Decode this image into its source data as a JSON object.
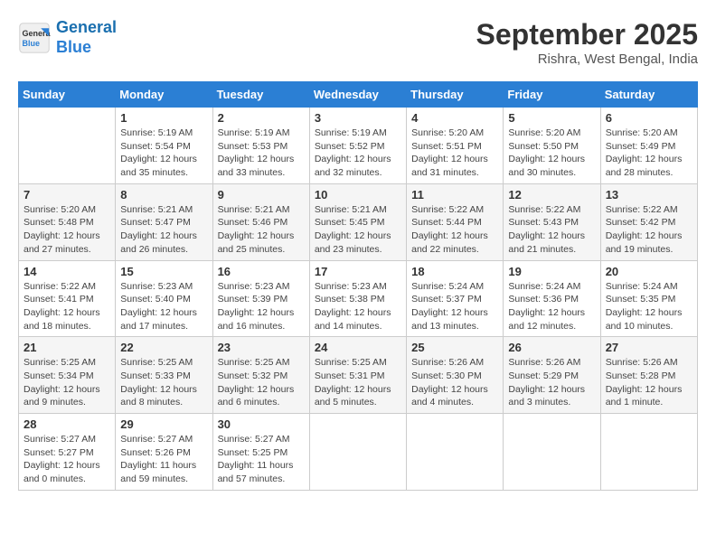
{
  "header": {
    "logo_line1": "General",
    "logo_line2": "Blue",
    "month": "September 2025",
    "location": "Rishra, West Bengal, India"
  },
  "days_of_week": [
    "Sunday",
    "Monday",
    "Tuesday",
    "Wednesday",
    "Thursday",
    "Friday",
    "Saturday"
  ],
  "weeks": [
    [
      {
        "day": "",
        "info": ""
      },
      {
        "day": "1",
        "info": "Sunrise: 5:19 AM\nSunset: 5:54 PM\nDaylight: 12 hours\nand 35 minutes."
      },
      {
        "day": "2",
        "info": "Sunrise: 5:19 AM\nSunset: 5:53 PM\nDaylight: 12 hours\nand 33 minutes."
      },
      {
        "day": "3",
        "info": "Sunrise: 5:19 AM\nSunset: 5:52 PM\nDaylight: 12 hours\nand 32 minutes."
      },
      {
        "day": "4",
        "info": "Sunrise: 5:20 AM\nSunset: 5:51 PM\nDaylight: 12 hours\nand 31 minutes."
      },
      {
        "day": "5",
        "info": "Sunrise: 5:20 AM\nSunset: 5:50 PM\nDaylight: 12 hours\nand 30 minutes."
      },
      {
        "day": "6",
        "info": "Sunrise: 5:20 AM\nSunset: 5:49 PM\nDaylight: 12 hours\nand 28 minutes."
      }
    ],
    [
      {
        "day": "7",
        "info": "Sunrise: 5:20 AM\nSunset: 5:48 PM\nDaylight: 12 hours\nand 27 minutes."
      },
      {
        "day": "8",
        "info": "Sunrise: 5:21 AM\nSunset: 5:47 PM\nDaylight: 12 hours\nand 26 minutes."
      },
      {
        "day": "9",
        "info": "Sunrise: 5:21 AM\nSunset: 5:46 PM\nDaylight: 12 hours\nand 25 minutes."
      },
      {
        "day": "10",
        "info": "Sunrise: 5:21 AM\nSunset: 5:45 PM\nDaylight: 12 hours\nand 23 minutes."
      },
      {
        "day": "11",
        "info": "Sunrise: 5:22 AM\nSunset: 5:44 PM\nDaylight: 12 hours\nand 22 minutes."
      },
      {
        "day": "12",
        "info": "Sunrise: 5:22 AM\nSunset: 5:43 PM\nDaylight: 12 hours\nand 21 minutes."
      },
      {
        "day": "13",
        "info": "Sunrise: 5:22 AM\nSunset: 5:42 PM\nDaylight: 12 hours\nand 19 minutes."
      }
    ],
    [
      {
        "day": "14",
        "info": "Sunrise: 5:22 AM\nSunset: 5:41 PM\nDaylight: 12 hours\nand 18 minutes."
      },
      {
        "day": "15",
        "info": "Sunrise: 5:23 AM\nSunset: 5:40 PM\nDaylight: 12 hours\nand 17 minutes."
      },
      {
        "day": "16",
        "info": "Sunrise: 5:23 AM\nSunset: 5:39 PM\nDaylight: 12 hours\nand 16 minutes."
      },
      {
        "day": "17",
        "info": "Sunrise: 5:23 AM\nSunset: 5:38 PM\nDaylight: 12 hours\nand 14 minutes."
      },
      {
        "day": "18",
        "info": "Sunrise: 5:24 AM\nSunset: 5:37 PM\nDaylight: 12 hours\nand 13 minutes."
      },
      {
        "day": "19",
        "info": "Sunrise: 5:24 AM\nSunset: 5:36 PM\nDaylight: 12 hours\nand 12 minutes."
      },
      {
        "day": "20",
        "info": "Sunrise: 5:24 AM\nSunset: 5:35 PM\nDaylight: 12 hours\nand 10 minutes."
      }
    ],
    [
      {
        "day": "21",
        "info": "Sunrise: 5:25 AM\nSunset: 5:34 PM\nDaylight: 12 hours\nand 9 minutes."
      },
      {
        "day": "22",
        "info": "Sunrise: 5:25 AM\nSunset: 5:33 PM\nDaylight: 12 hours\nand 8 minutes."
      },
      {
        "day": "23",
        "info": "Sunrise: 5:25 AM\nSunset: 5:32 PM\nDaylight: 12 hours\nand 6 minutes."
      },
      {
        "day": "24",
        "info": "Sunrise: 5:25 AM\nSunset: 5:31 PM\nDaylight: 12 hours\nand 5 minutes."
      },
      {
        "day": "25",
        "info": "Sunrise: 5:26 AM\nSunset: 5:30 PM\nDaylight: 12 hours\nand 4 minutes."
      },
      {
        "day": "26",
        "info": "Sunrise: 5:26 AM\nSunset: 5:29 PM\nDaylight: 12 hours\nand 3 minutes."
      },
      {
        "day": "27",
        "info": "Sunrise: 5:26 AM\nSunset: 5:28 PM\nDaylight: 12 hours\nand 1 minute."
      }
    ],
    [
      {
        "day": "28",
        "info": "Sunrise: 5:27 AM\nSunset: 5:27 PM\nDaylight: 12 hours\nand 0 minutes."
      },
      {
        "day": "29",
        "info": "Sunrise: 5:27 AM\nSunset: 5:26 PM\nDaylight: 11 hours\nand 59 minutes."
      },
      {
        "day": "30",
        "info": "Sunrise: 5:27 AM\nSunset: 5:25 PM\nDaylight: 11 hours\nand 57 minutes."
      },
      {
        "day": "",
        "info": ""
      },
      {
        "day": "",
        "info": ""
      },
      {
        "day": "",
        "info": ""
      },
      {
        "day": "",
        "info": ""
      }
    ]
  ]
}
